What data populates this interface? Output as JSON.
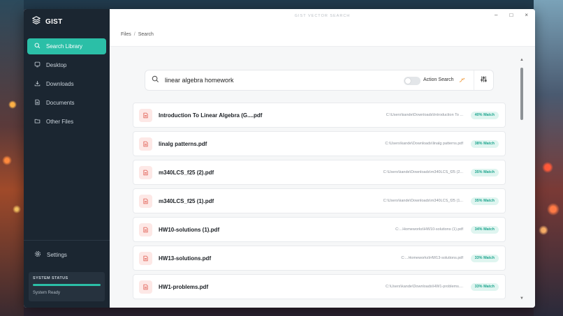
{
  "app": {
    "brand": "GIST",
    "caption": "GIST VECTOR SEARCH",
    "controls": {
      "minimize": "–",
      "maximize": "□",
      "close": "×"
    }
  },
  "sidebar": {
    "items": [
      {
        "label": "Search Library",
        "icon": "search-icon",
        "active": true
      },
      {
        "label": "Desktop",
        "icon": "monitor-icon"
      },
      {
        "label": "Downloads",
        "icon": "download-icon"
      },
      {
        "label": "Documents",
        "icon": "document-icon"
      },
      {
        "label": "Other Files",
        "icon": "folder-icon"
      }
    ],
    "settings": "Settings",
    "status": {
      "title": "SYSTEM STATUS",
      "text": "System Ready",
      "progress": 1.0
    }
  },
  "breadcrumb": {
    "root": "Files",
    "separator": "/",
    "current": "Search"
  },
  "search": {
    "value": "linear algebra homework",
    "action_label": "Action Search"
  },
  "results": [
    {
      "name": "Introduction To Linear Algebra (G....pdf",
      "path": "C:\\Users\\kande\\Downloads\\Introduction To ...",
      "match": "40% Match"
    },
    {
      "name": "linalg patterns.pdf",
      "path": "C:\\Users\\kande\\Downloads\\linalg patterns.pdf",
      "match": "38% Match"
    },
    {
      "name": "m340LCS_f25 (2).pdf",
      "path": "C:\\Users\\kande\\Downloads\\m340LCS_f25 (2...",
      "match": "35% Match"
    },
    {
      "name": "m340LCS_f25 (1).pdf",
      "path": "C:\\Users\\kande\\Downloads\\m340LCS_f25 (1...",
      "match": "35% Match"
    },
    {
      "name": "HW10-solutions (1).pdf",
      "path": "C:...Homeworks\\HW10-solutions (1).pdf",
      "match": "34% Match"
    },
    {
      "name": "HW13-solutions.pdf",
      "path": "C:...Homeworks\\HW13-solutions.pdf",
      "match": "33% Match"
    },
    {
      "name": "HW1-problems.pdf",
      "path": "C:\\Users\\kande\\Downloads\\HW1-problems....",
      "match": "33% Match"
    }
  ],
  "colors": {
    "accent": "#2bbfa7",
    "sidebar": "#1b2631",
    "file_icon": "#e05a4f"
  }
}
